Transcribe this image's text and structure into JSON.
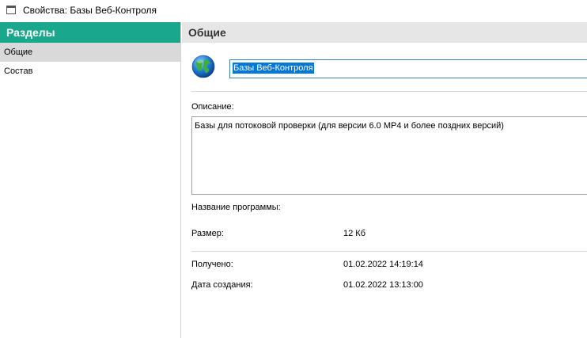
{
  "window": {
    "title": "Свойства: Базы Веб-Контроля"
  },
  "sidebar": {
    "header": "Разделы",
    "items": [
      {
        "label": "Общие",
        "selected": true
      },
      {
        "label": "Состав",
        "selected": false
      }
    ]
  },
  "main": {
    "header": "Общие",
    "icon": "globe-icon",
    "name_value": "Базы Веб-Контроля",
    "description_label": "Описание:",
    "description_value": "Базы для потоковой проверки (для версии 6.0 MP4 и более поздних версий)",
    "program_name_label": "Название программы:",
    "size_label": "Размер:",
    "size_value": "12 Кб",
    "received_label": "Получено:",
    "received_value": "01.02.2022 14:19:14",
    "created_label": "Дата создания:",
    "created_value": "01.02.2022 13:13:00"
  },
  "colors": {
    "sidebar_header_bg": "#1aa88d",
    "main_header_bg": "#e6e6e6",
    "selected_item_bg": "#d9d9d9",
    "selection_highlight": "#0078d7"
  }
}
